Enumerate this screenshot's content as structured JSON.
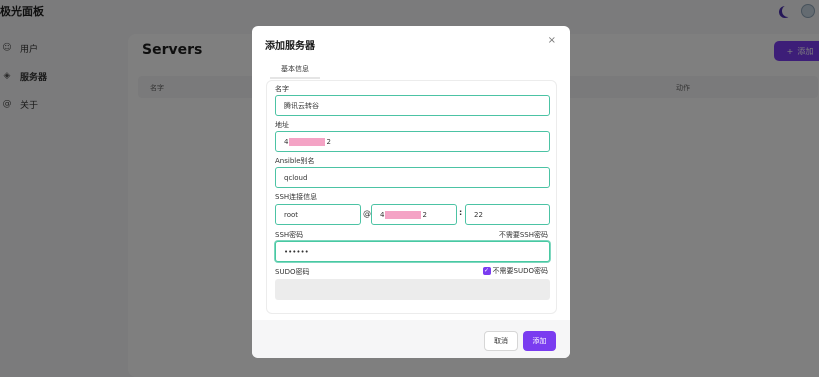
{
  "app": {
    "brand": "极光面板"
  },
  "sidebar": {
    "items": [
      {
        "icon": "user-icon",
        "label": "用户"
      },
      {
        "icon": "layers-icon",
        "label": "服务器"
      },
      {
        "icon": "at-icon",
        "label": "关于"
      }
    ]
  },
  "main": {
    "title": "Servers",
    "add_label": "添加",
    "columns": {
      "name": "名字",
      "action": "动作"
    }
  },
  "modal": {
    "title": "添加服务器",
    "close_glyph": "×",
    "tab": "基本信息",
    "fields": {
      "name_label": "名字",
      "name_value": "腾讯云转谷",
      "address_label": "地址",
      "address_prefix": "4",
      "address_suffix": "2",
      "ansible_label": "Ansible别名",
      "ansible_value": "qcloud",
      "ssh_label": "SSH连接信息",
      "ssh_user": "root",
      "ssh_at": "@",
      "ssh_host_prefix": "4",
      "ssh_host_suffix": "2",
      "ssh_colon": ":",
      "ssh_port": "22",
      "ssh_password_label": "SSH密码",
      "ssh_password_hint": "不需要SSH密码",
      "ssh_password_value": "••••••",
      "sudo_label": "SUDO密码",
      "sudo_checkbox_label": "不需要SUDO密码"
    },
    "buttons": {
      "cancel": "取消",
      "add": "添加"
    }
  },
  "colors": {
    "accent": "#7a3cf0",
    "focus": "#4cc3a4",
    "redaction": "#f4a3c5"
  }
}
